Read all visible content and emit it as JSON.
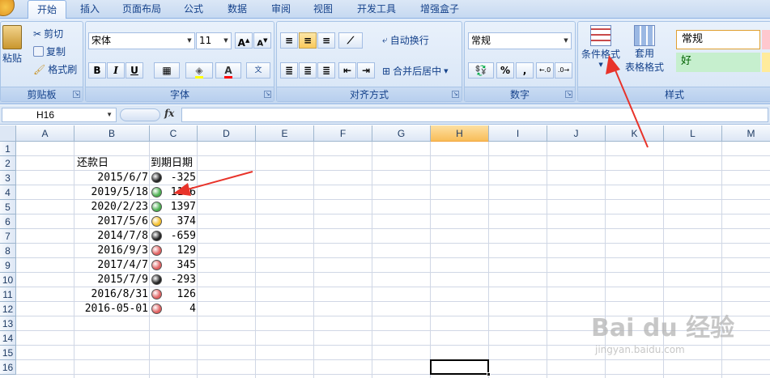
{
  "tabs": [
    {
      "label": "开始",
      "active": true
    },
    {
      "label": "插入"
    },
    {
      "label": "页面布局"
    },
    {
      "label": "公式"
    },
    {
      "label": "数据"
    },
    {
      "label": "审阅"
    },
    {
      "label": "视图"
    },
    {
      "label": "开发工具"
    },
    {
      "label": "增强盒子"
    }
  ],
  "clipboard": {
    "paste": "粘贴",
    "cut": "剪切",
    "copy": "复制",
    "format_painter": "格式刷",
    "label": "剪贴板"
  },
  "font": {
    "name": "宋体",
    "size": "11",
    "bold": "B",
    "italic": "I",
    "underline": "U",
    "label": "字体"
  },
  "alignment": {
    "wrap": "自动换行",
    "merge": "合并后居中",
    "label": "对齐方式"
  },
  "number": {
    "format": "常规",
    "percent": "%",
    "comma": ",",
    "label": "数字"
  },
  "styles": {
    "conditional": "条件格式",
    "table_line1": "套用",
    "table_line2": "表格格式",
    "normal": "常规",
    "good": "好",
    "label": "样式"
  },
  "formula_bar": {
    "name_box": "H16",
    "fx": "fx",
    "value": ""
  },
  "columns": [
    "A",
    "B",
    "C",
    "D",
    "E",
    "F",
    "G",
    "H",
    "I",
    "J",
    "K",
    "L",
    "M"
  ],
  "selected_column": "H",
  "rows": [
    "1",
    "2",
    "3",
    "4",
    "5",
    "6",
    "7",
    "8",
    "9",
    "10",
    "11",
    "12",
    "13",
    "14",
    "15",
    "16"
  ],
  "headers": {
    "b2": "还款日",
    "c2": "到期日期"
  },
  "data_rows": [
    {
      "date": "2015/6/7",
      "value": "-325",
      "status": "black"
    },
    {
      "date": "2019/5/18",
      "value": "1116",
      "status": "green"
    },
    {
      "date": "2020/2/23",
      "value": "1397",
      "status": "green"
    },
    {
      "date": "2017/5/6",
      "value": "374",
      "status": "yellow"
    },
    {
      "date": "2014/7/8",
      "value": "-659",
      "status": "black"
    },
    {
      "date": "2016/9/3",
      "value": "129",
      "status": "red"
    },
    {
      "date": "2017/4/7",
      "value": "345",
      "status": "red"
    },
    {
      "date": "2015/7/9",
      "value": "-293",
      "status": "black"
    },
    {
      "date": "2016/8/31",
      "value": "126",
      "status": "red"
    },
    {
      "date": "2016-05-01",
      "value": "4",
      "status": "red"
    }
  ],
  "status_colors": {
    "black": "#222222",
    "green": "#4caf50",
    "yellow": "#f5c02e",
    "red": "#e06060"
  },
  "watermark": {
    "line1": "Bai du 经验",
    "line2": "jingyan.baidu.com"
  }
}
